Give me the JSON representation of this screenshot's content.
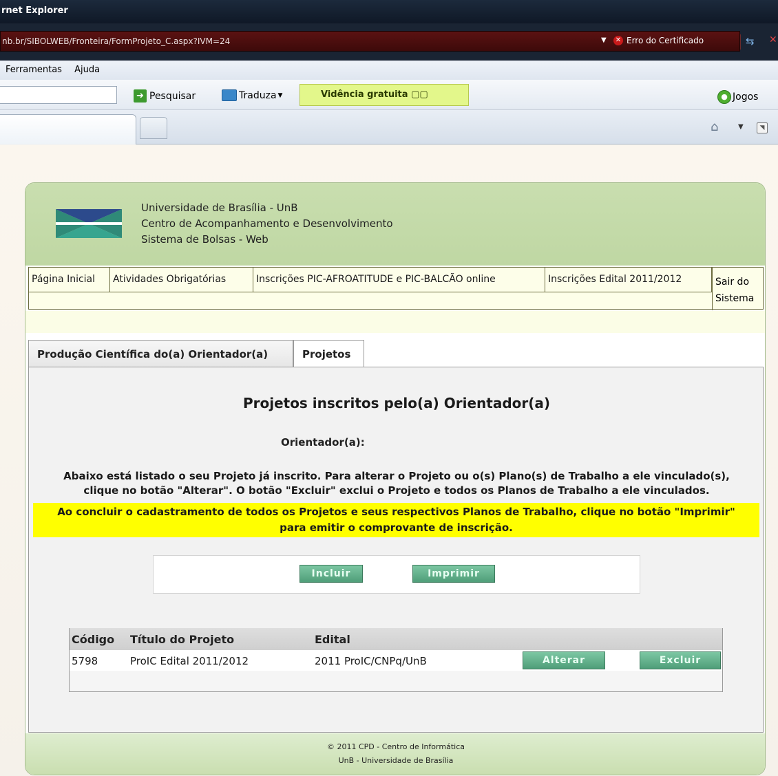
{
  "window": {
    "title": "rnet Explorer"
  },
  "address": {
    "url": "nb.br/SIBOLWEB/Fronteira/FormProjeto_C.aspx?IVM=24",
    "cert_error": "Erro do Certificado"
  },
  "menu": {
    "items": [
      "Ferramentas",
      "Ajuda"
    ]
  },
  "toolbar": {
    "search_label": "Pesquisar",
    "translate_label": "Traduza",
    "banner_text": "Vidência gratuita",
    "games_label": "Jogos"
  },
  "site": {
    "line1": "Universidade de Brasília - UnB",
    "line2": "Centro de Acompanhamento e Desenvolvimento",
    "line3": "Sistema de Bolsas - Web"
  },
  "nav": {
    "items": [
      "Página Inicial",
      "Atividades Obrigatórias",
      "Inscrições PIC-AFROATITUDE e PIC-BALCÃO online",
      "Inscrições Edital 2011/2012"
    ],
    "logout_line1": "Sair do",
    "logout_line2": "Sistema"
  },
  "tabs": {
    "producao": "Produção Científica do(a) Orientador(a)",
    "projetos": "Projetos"
  },
  "content": {
    "title": "Projetos inscritos pelo(a) Orientador(a)",
    "orientador_label": "Orientador(a):",
    "info_line1": "Abaixo está listado o seu Projeto já inscrito. Para alterar o Projeto ou o(s) Plano(s) de Trabalho a ele vinculado(s),",
    "info_line2": "clique no botão \"Alterar\". O botão \"Excluir\" exclui o Projeto e todos os Planos de Trabalho a ele vinculados.",
    "highlight_line1": "Ao concluir o cadastramento de todos os Projetos e seus respectivos Planos de Trabalho, clique no botão \"Imprimir\"",
    "highlight_line2": "para emitir o comprovante de inscrição.",
    "include_button": "Incluir",
    "print_button": "Imprimir"
  },
  "table": {
    "headers": {
      "code": "Código",
      "title": "Título do Projeto",
      "edital": "Edital"
    },
    "rows": [
      {
        "code": "5798",
        "title": "ProIC Edital 2011/2012",
        "edital": "2011 ProIC/CNPq/UnB",
        "alter": "Alterar",
        "delete": "Excluir"
      }
    ]
  },
  "footer": {
    "line1": "© 2011 CPD - Centro de Informática",
    "line2": "UnB - Universidade de Brasília"
  }
}
